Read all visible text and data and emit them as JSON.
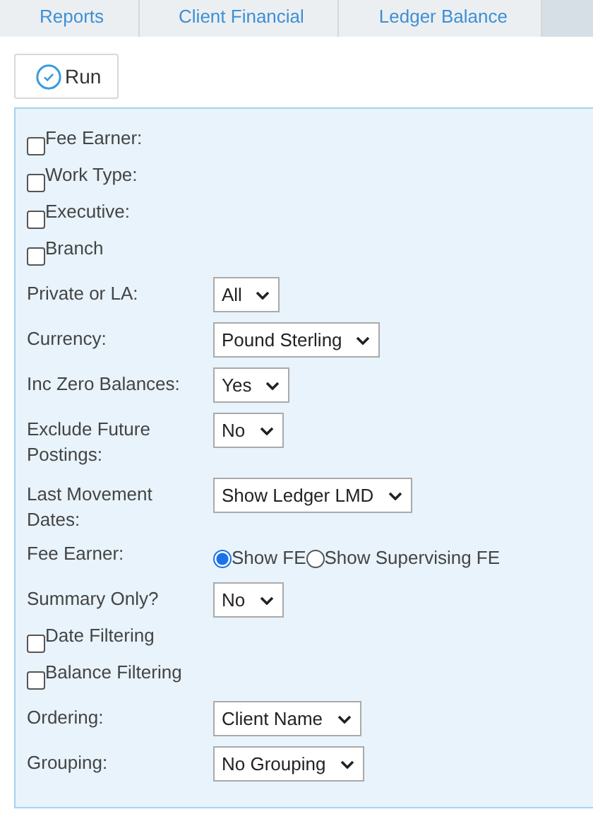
{
  "breadcrumbs": [
    {
      "label": "Reports"
    },
    {
      "label": "Client Financial"
    },
    {
      "label": "Ledger Balance"
    }
  ],
  "run_button": {
    "label": "Run"
  },
  "fields": [
    {
      "kind": "checkbox",
      "label": "Fee Earner:",
      "checked": false
    },
    {
      "kind": "checkbox",
      "label": "Work Type:",
      "checked": false
    },
    {
      "kind": "checkbox",
      "label": "Executive:",
      "checked": false
    },
    {
      "kind": "checkbox",
      "label": "Branch",
      "checked": false
    },
    {
      "kind": "select",
      "label": "Private or LA:",
      "value": "All"
    },
    {
      "kind": "select",
      "label": "Currency:",
      "value": "Pound Sterling"
    },
    {
      "kind": "select",
      "label": "Inc Zero Balances:",
      "value": "Yes"
    },
    {
      "kind": "select",
      "label": "Exclude Future Postings:",
      "value": "No"
    },
    {
      "kind": "select",
      "label": "Last Movement Dates:",
      "value": "Show Ledger LMD"
    },
    {
      "kind": "radio",
      "label": "Fee Earner:",
      "options": [
        {
          "label": "Show FE",
          "selected": true
        },
        {
          "label": "Show Supervising FE",
          "selected": false
        }
      ]
    },
    {
      "kind": "select",
      "label": "Summary Only?",
      "value": "No"
    },
    {
      "kind": "checkbox",
      "label": "Date Filtering",
      "checked": false
    },
    {
      "kind": "checkbox",
      "label": "Balance Filtering",
      "checked": false
    },
    {
      "kind": "select",
      "label": "Ordering:",
      "value": "Client Name"
    },
    {
      "kind": "select",
      "label": "Grouping:",
      "value": "No Grouping"
    }
  ]
}
